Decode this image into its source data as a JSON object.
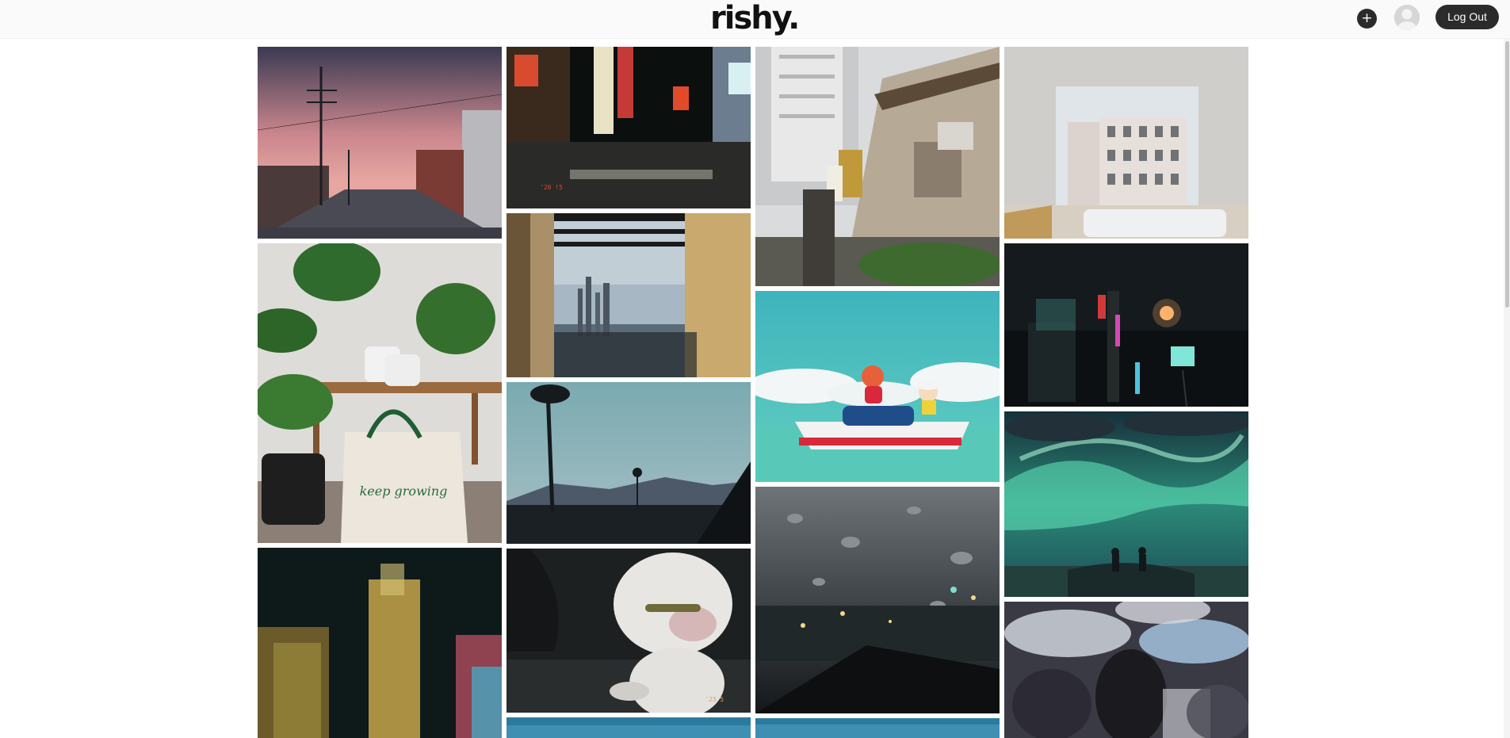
{
  "app": {
    "logo": "rishy."
  },
  "header": {
    "add_label": "+",
    "add_icon": "plus-icon",
    "avatar_icon": "user-avatar-icon",
    "logout_label": "Log Out"
  },
  "gallery": {
    "column_count": 4,
    "photos": [
      {
        "subject": "sunset-street-power-lines"
      },
      {
        "subject": "shibuya-crossing-night"
      },
      {
        "subject": "tokyo-alley-shops"
      },
      {
        "subject": "window-view-building"
      },
      {
        "subject": "city-skyline-through-curtains"
      },
      {
        "subject": "monstera-plants-sneakers-tote"
      },
      {
        "subject": "anime-boat-ponyo"
      },
      {
        "subject": "tokyo-night-neon"
      },
      {
        "subject": "palm-tree-hollywood-hills"
      },
      {
        "subject": "anime-aurora-sky"
      },
      {
        "subject": "rain-on-window-city-night"
      },
      {
        "subject": "bulldog-night-photo"
      },
      {
        "subject": "blurred-city-lights"
      },
      {
        "subject": "crowd-umbrellas"
      },
      {
        "subject": "blue-sky-partial"
      },
      {
        "subject": "blue-sky-partial-2"
      }
    ],
    "tote_text": "keep growing",
    "photo_stamp_1": "'20 !5",
    "photo_stamp_2": "'23 5"
  }
}
